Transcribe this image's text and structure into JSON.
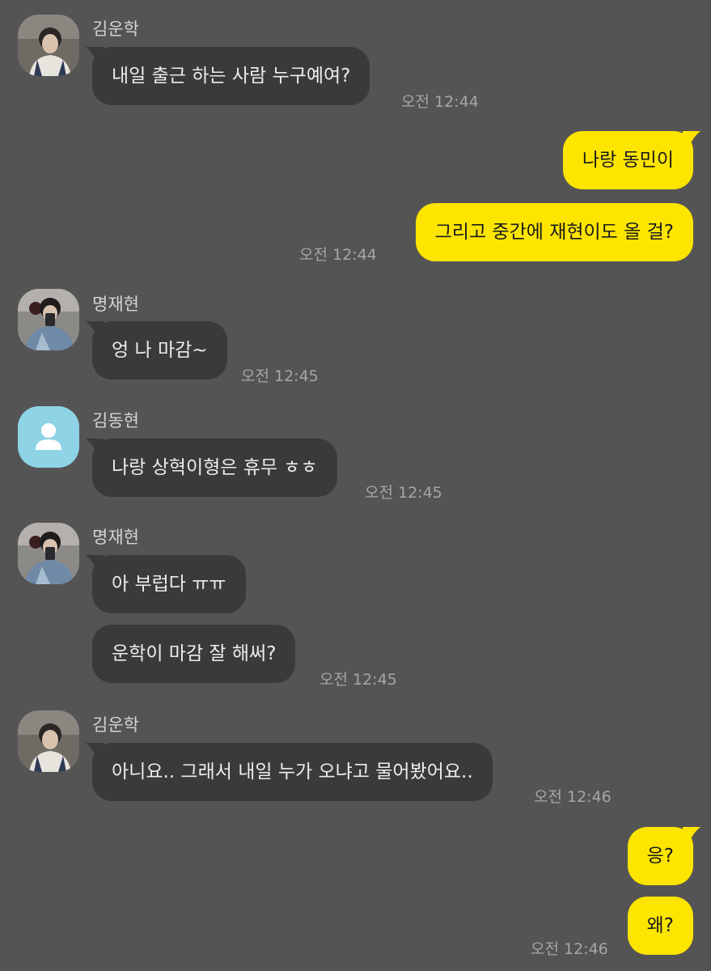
{
  "colors": {
    "background": "#555455",
    "incoming_bubble": "#3a3a3c",
    "outgoing_bubble": "#fde500",
    "name_text": "#d4d4d4",
    "time_text": "#a6a6a6"
  },
  "messages": [
    {
      "sender": "김운학",
      "avatar": "photo-avatar",
      "text": "내일 출근 하는 사람 누구예여?",
      "time": "오전 12:44"
    },
    {
      "sender": "me",
      "text": "나랑 동민이"
    },
    {
      "sender": "me",
      "text": "그리고 중간에 재현이도 올 걸?",
      "time": "오전 12:44"
    },
    {
      "sender": "명재현",
      "avatar": "photo-avatar",
      "text": "엉 나 마감~",
      "time": "오전 12:45"
    },
    {
      "sender": "김동현",
      "avatar": "default-person-icon",
      "text": "나랑 상혁이형은 휴무 ㅎㅎ",
      "time": "오전 12:45"
    },
    {
      "sender": "명재현",
      "avatar": "photo-avatar",
      "text": "아 부럽다 ㅠㅠ"
    },
    {
      "sender": "명재현",
      "text": "운학이 마감 잘 해써?",
      "time": "오전 12:45"
    },
    {
      "sender": "김운학",
      "avatar": "photo-avatar",
      "text": "아니요.. 그래서 내일 누가 오냐고 물어봤어요..",
      "time": "오전 12:46"
    },
    {
      "sender": "me",
      "text": "응?"
    },
    {
      "sender": "me",
      "text": "왜?",
      "time": "오전 12:46"
    }
  ]
}
